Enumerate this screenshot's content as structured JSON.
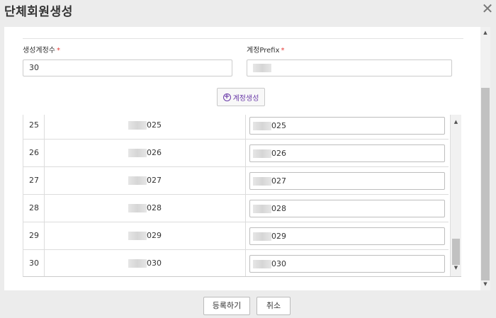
{
  "dialog": {
    "title": "단체회원생성",
    "close_symbol": "✕"
  },
  "form": {
    "count_label": "생성계정수",
    "count_value": "30",
    "prefix_label": "계정Prefix",
    "required_mark": "*",
    "generate_label": "계정생성"
  },
  "table": {
    "rows": [
      {
        "no": "25",
        "id_suffix": "025",
        "input_suffix": "025"
      },
      {
        "no": "26",
        "id_suffix": "026",
        "input_suffix": "026"
      },
      {
        "no": "27",
        "id_suffix": "027",
        "input_suffix": "027"
      },
      {
        "no": "28",
        "id_suffix": "028",
        "input_suffix": "028"
      },
      {
        "no": "29",
        "id_suffix": "029",
        "input_suffix": "029"
      },
      {
        "no": "30",
        "id_suffix": "030",
        "input_suffix": "030"
      }
    ]
  },
  "footer": {
    "register_label": "등록하기",
    "cancel_label": "취소"
  },
  "colors": {
    "accent": "#6a3aa8",
    "required": "#e53935"
  }
}
